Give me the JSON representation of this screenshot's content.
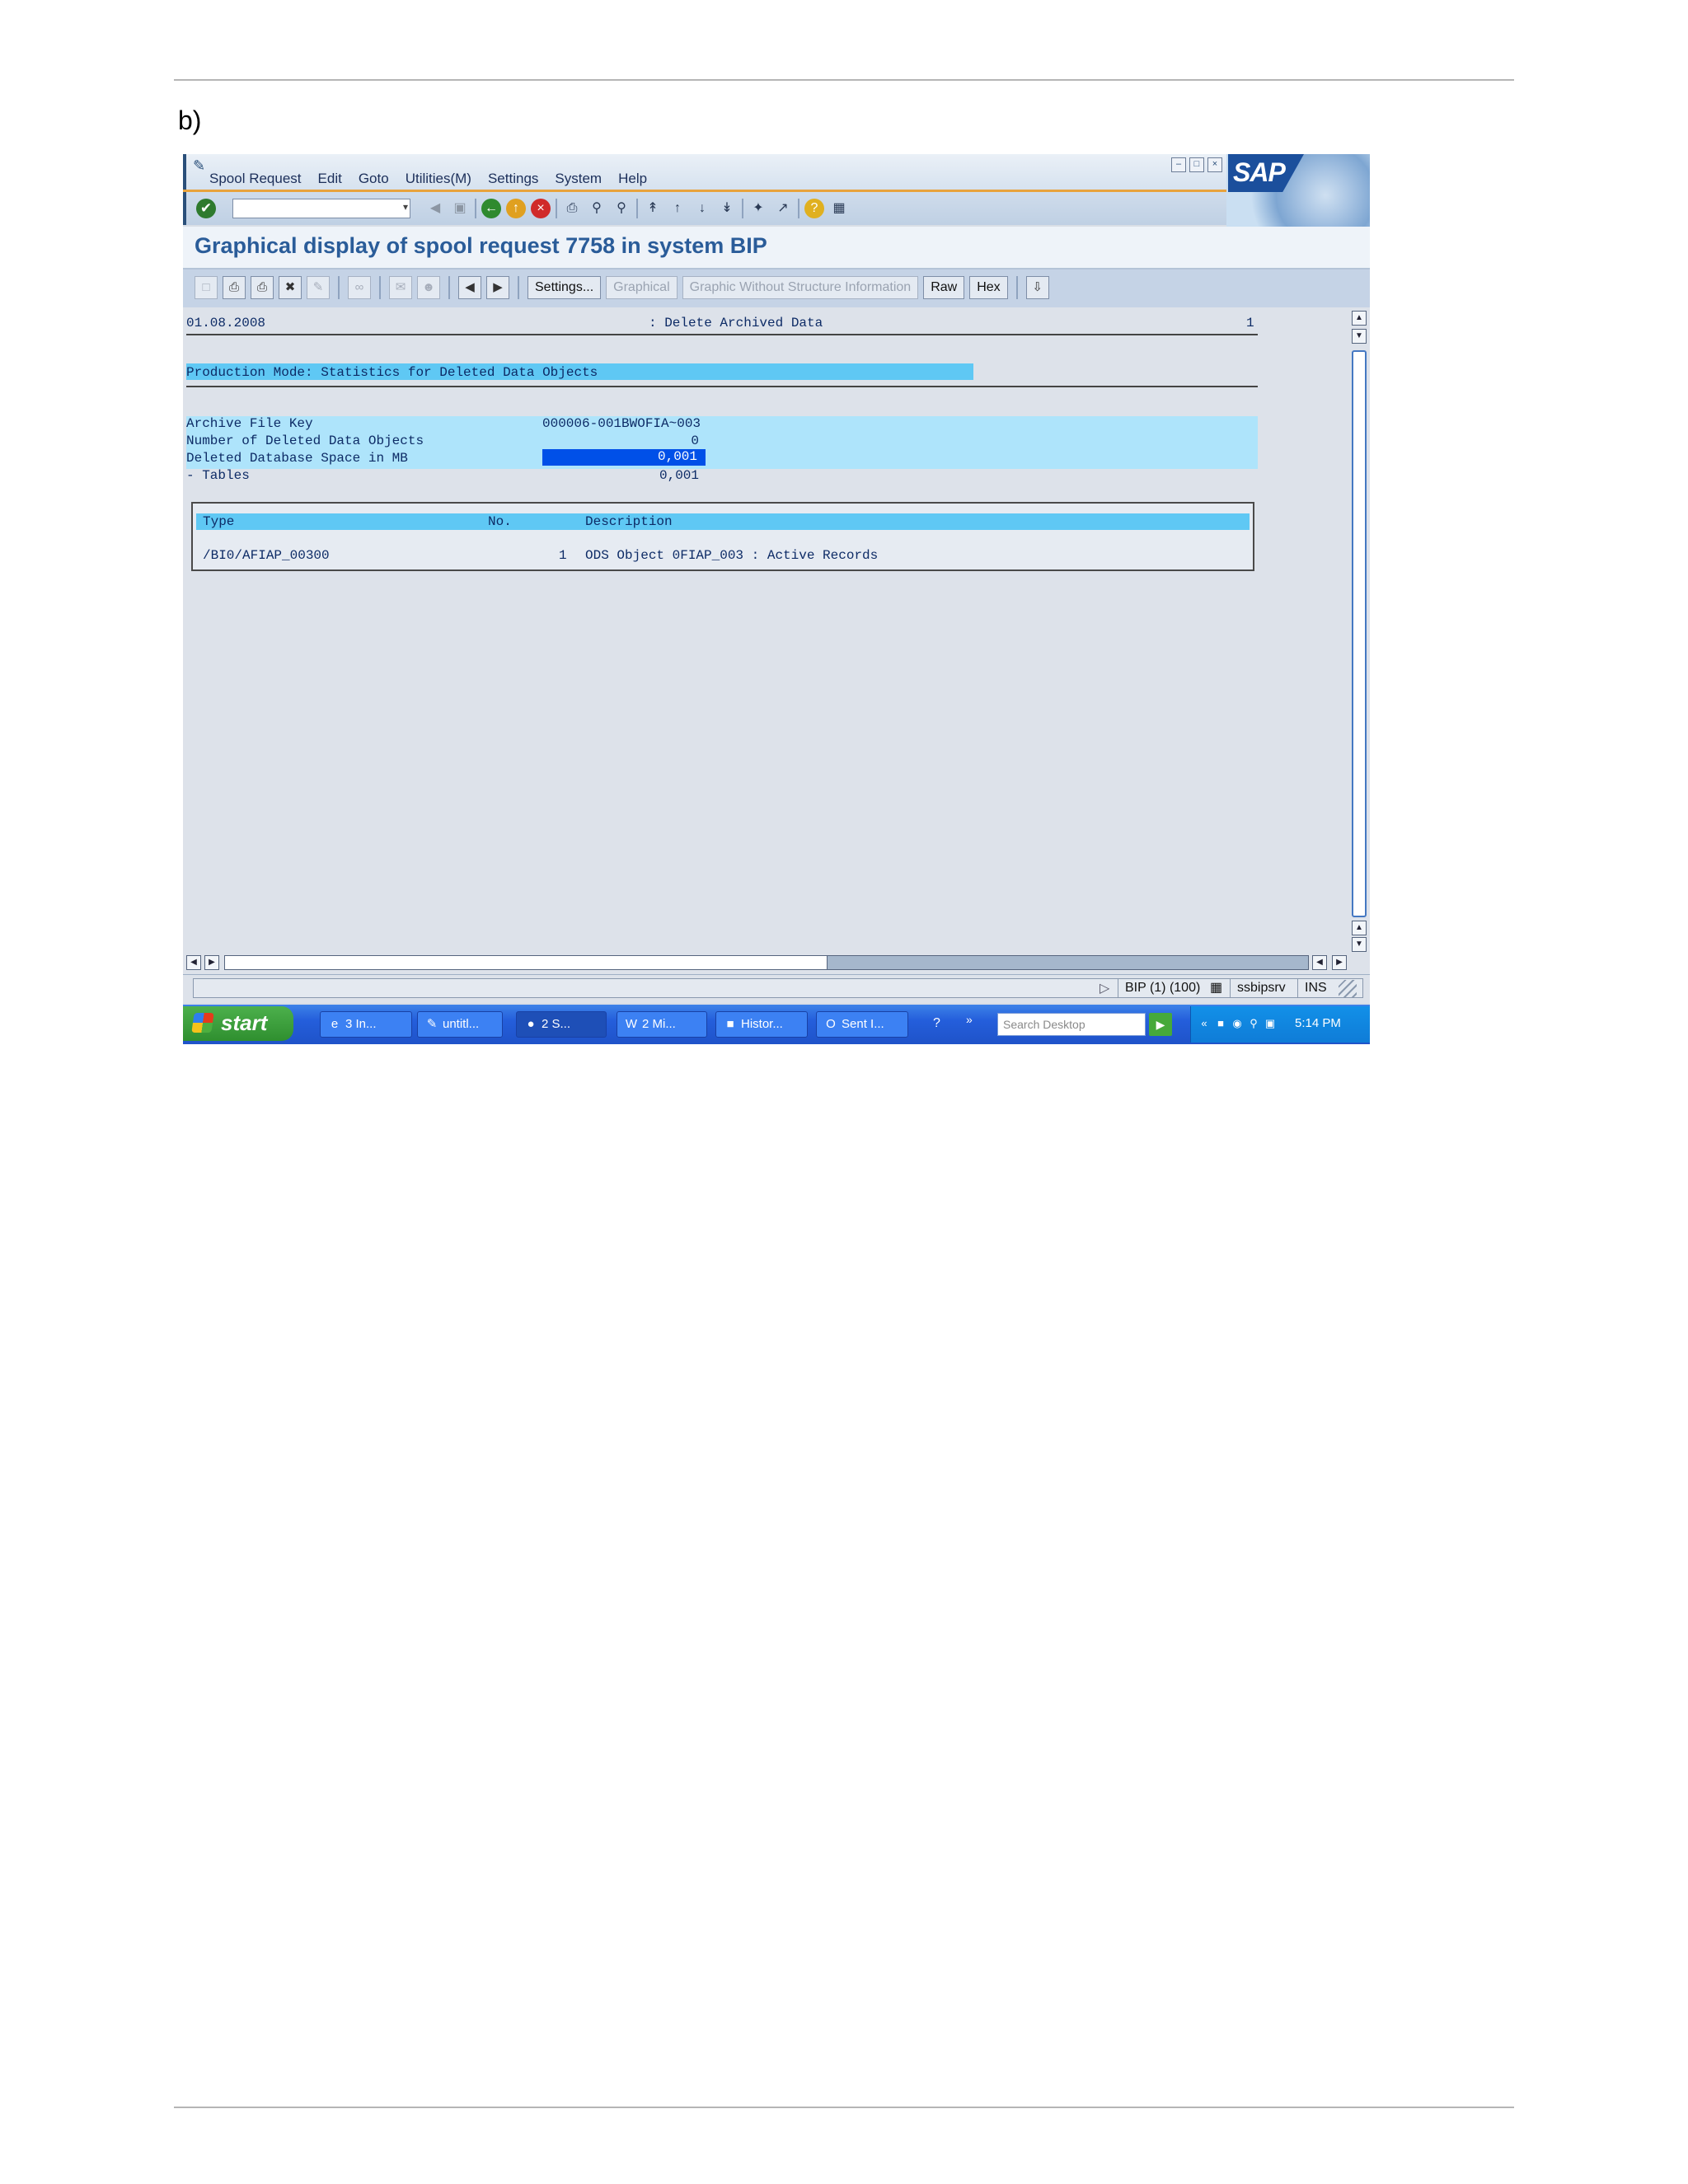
{
  "doc": {
    "label": "b)"
  },
  "menu": {
    "items": [
      "Spool Request",
      "Edit",
      "Goto",
      "Utilities(M)",
      "Settings",
      "System",
      "Help"
    ]
  },
  "sap_logo": "SAP",
  "title": "Graphical display of spool request 7758 in system BIP",
  "app_toolbar": {
    "settings": "Settings...",
    "graphical": "Graphical",
    "graphic_without": "Graphic Without Structure Information",
    "raw": "Raw",
    "hex": "Hex"
  },
  "report": {
    "date": "01.08.2008",
    "heading": ": Delete Archived Data",
    "page_number": "1",
    "section_title": "Production Mode: Statistics for Deleted Data Objects",
    "rows": [
      {
        "label": "Archive File Key",
        "value": "000006-001BWOFIA~003"
      },
      {
        "label": "Number of Deleted Data Objects",
        "value": "0"
      },
      {
        "label": "Deleted Database Space in MB",
        "value": "0,001"
      },
      {
        "label": "- Tables",
        "value": "0,001"
      }
    ],
    "table": {
      "headers": {
        "type": "Type",
        "no": "No.",
        "description": "Description"
      },
      "row": {
        "type": "/BI0/AFIAP_00300",
        "no": "1",
        "description": "ODS Object 0FIAP_003 : Active Records"
      }
    }
  },
  "status": {
    "system": "BIP (1) (100)",
    "server": "ssbipsrv",
    "mode": "INS"
  },
  "taskbar": {
    "start": "start",
    "tasks": [
      "3 In...",
      "untitl...",
      "2 S...",
      "2 Mi...",
      "Histor...",
      "Sent I..."
    ],
    "search_placeholder": "Search Desktop",
    "clock": "5:14 PM"
  },
  "colors": {
    "title_blue": "#2a5c99",
    "band_cyan": "#5fc8f4",
    "selection_blue": "#0050e8",
    "taskbar_blue": "#245edb",
    "start_green": "#2f8f2f"
  }
}
